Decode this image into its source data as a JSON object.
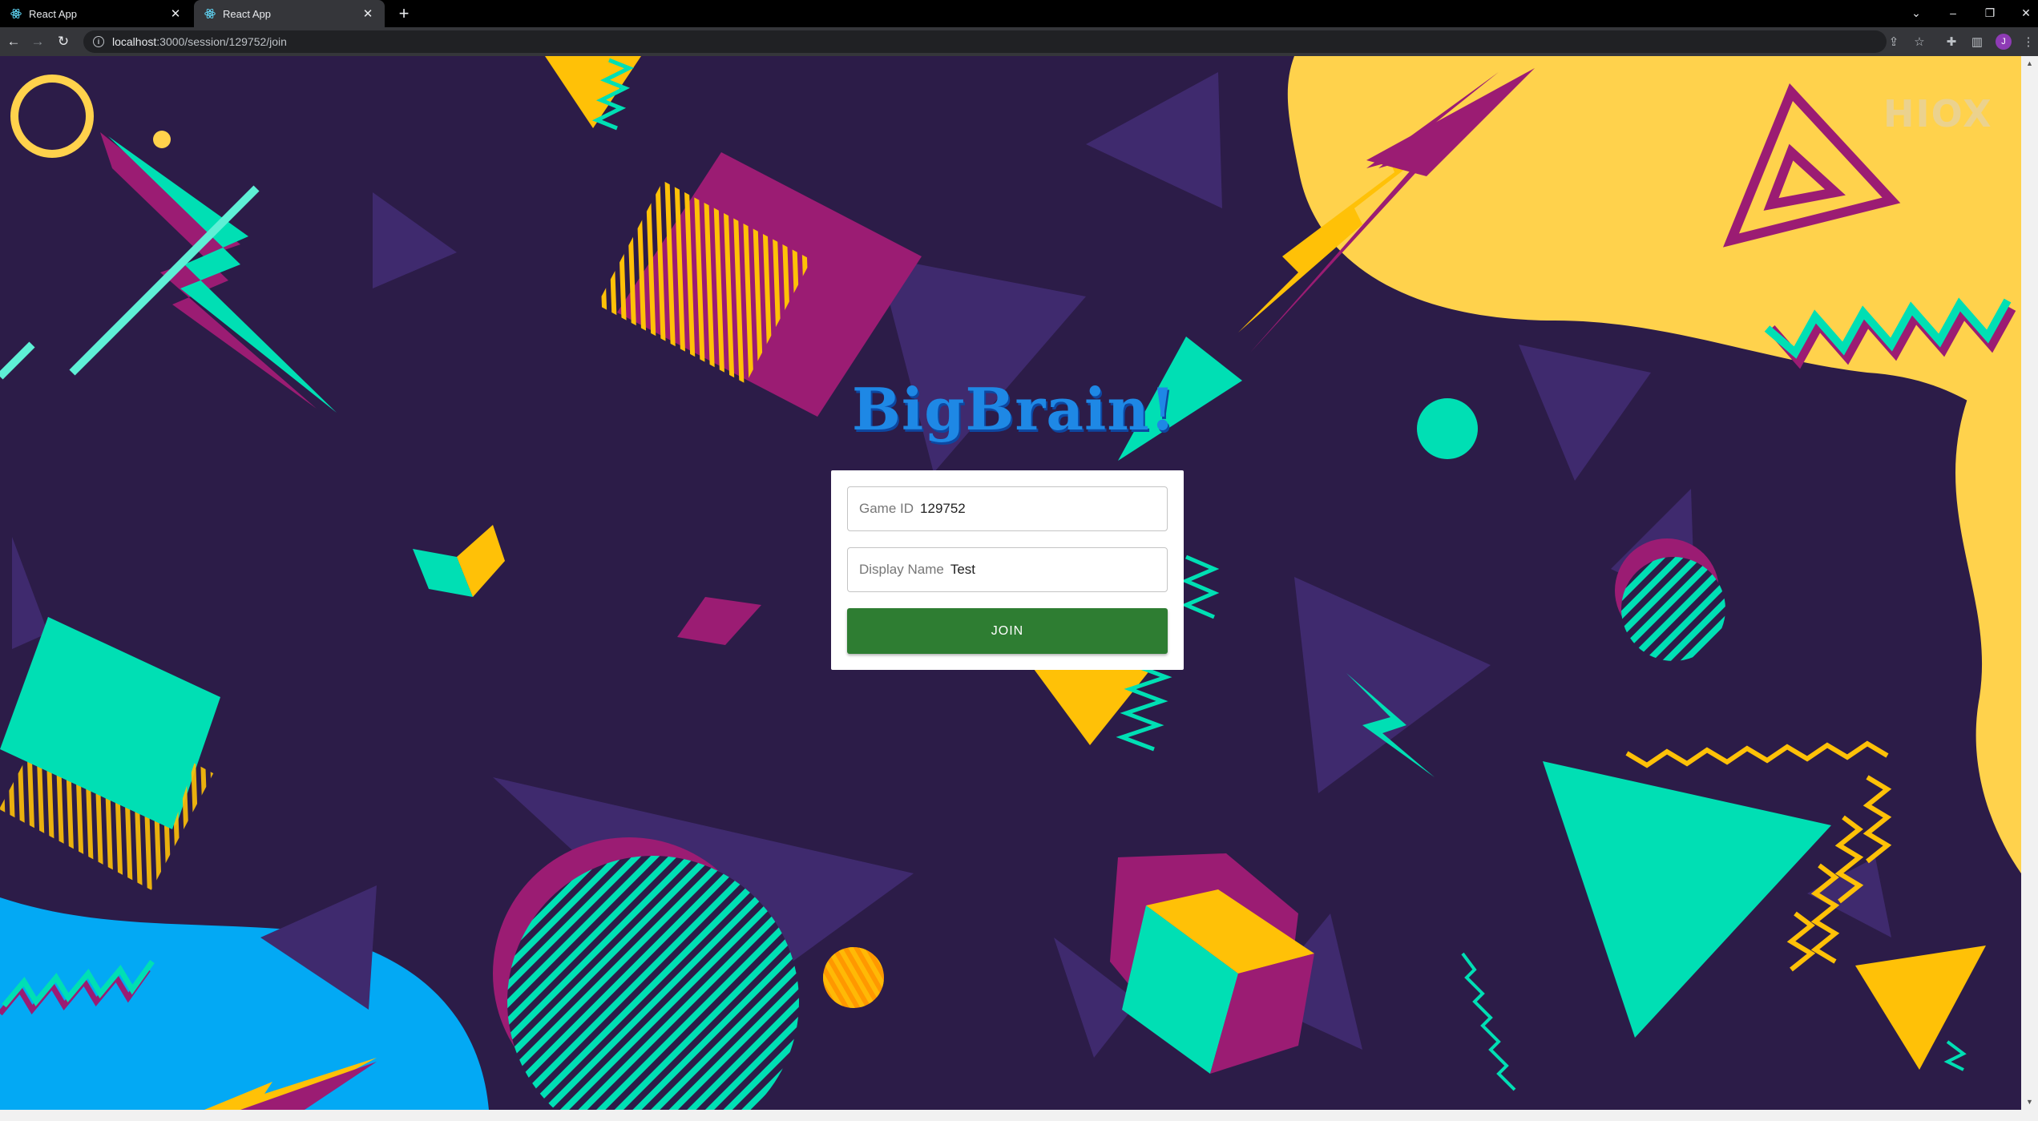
{
  "browser": {
    "tabs": [
      {
        "title": "React App",
        "active": false
      },
      {
        "title": "React App",
        "active": true
      }
    ],
    "address": {
      "host": "localhost",
      "path": ":3000/session/129752/join"
    },
    "profile_initial": "J"
  },
  "page": {
    "logo_text": "BigBrain!",
    "watermark": "HIOX",
    "form": {
      "game_id_label": "Game ID",
      "game_id_value": "129752",
      "display_name_label": "Display Name",
      "display_name_value": "Test",
      "join_label": "JOIN"
    }
  },
  "colors": {
    "background": "#2c1c48",
    "teal": "#00dfb4",
    "magenta": "#9b1c73",
    "yellow": "#ffc107",
    "blue": "#03a9f4",
    "join_button": "#2e7d32",
    "logo": "#1e88e5"
  }
}
